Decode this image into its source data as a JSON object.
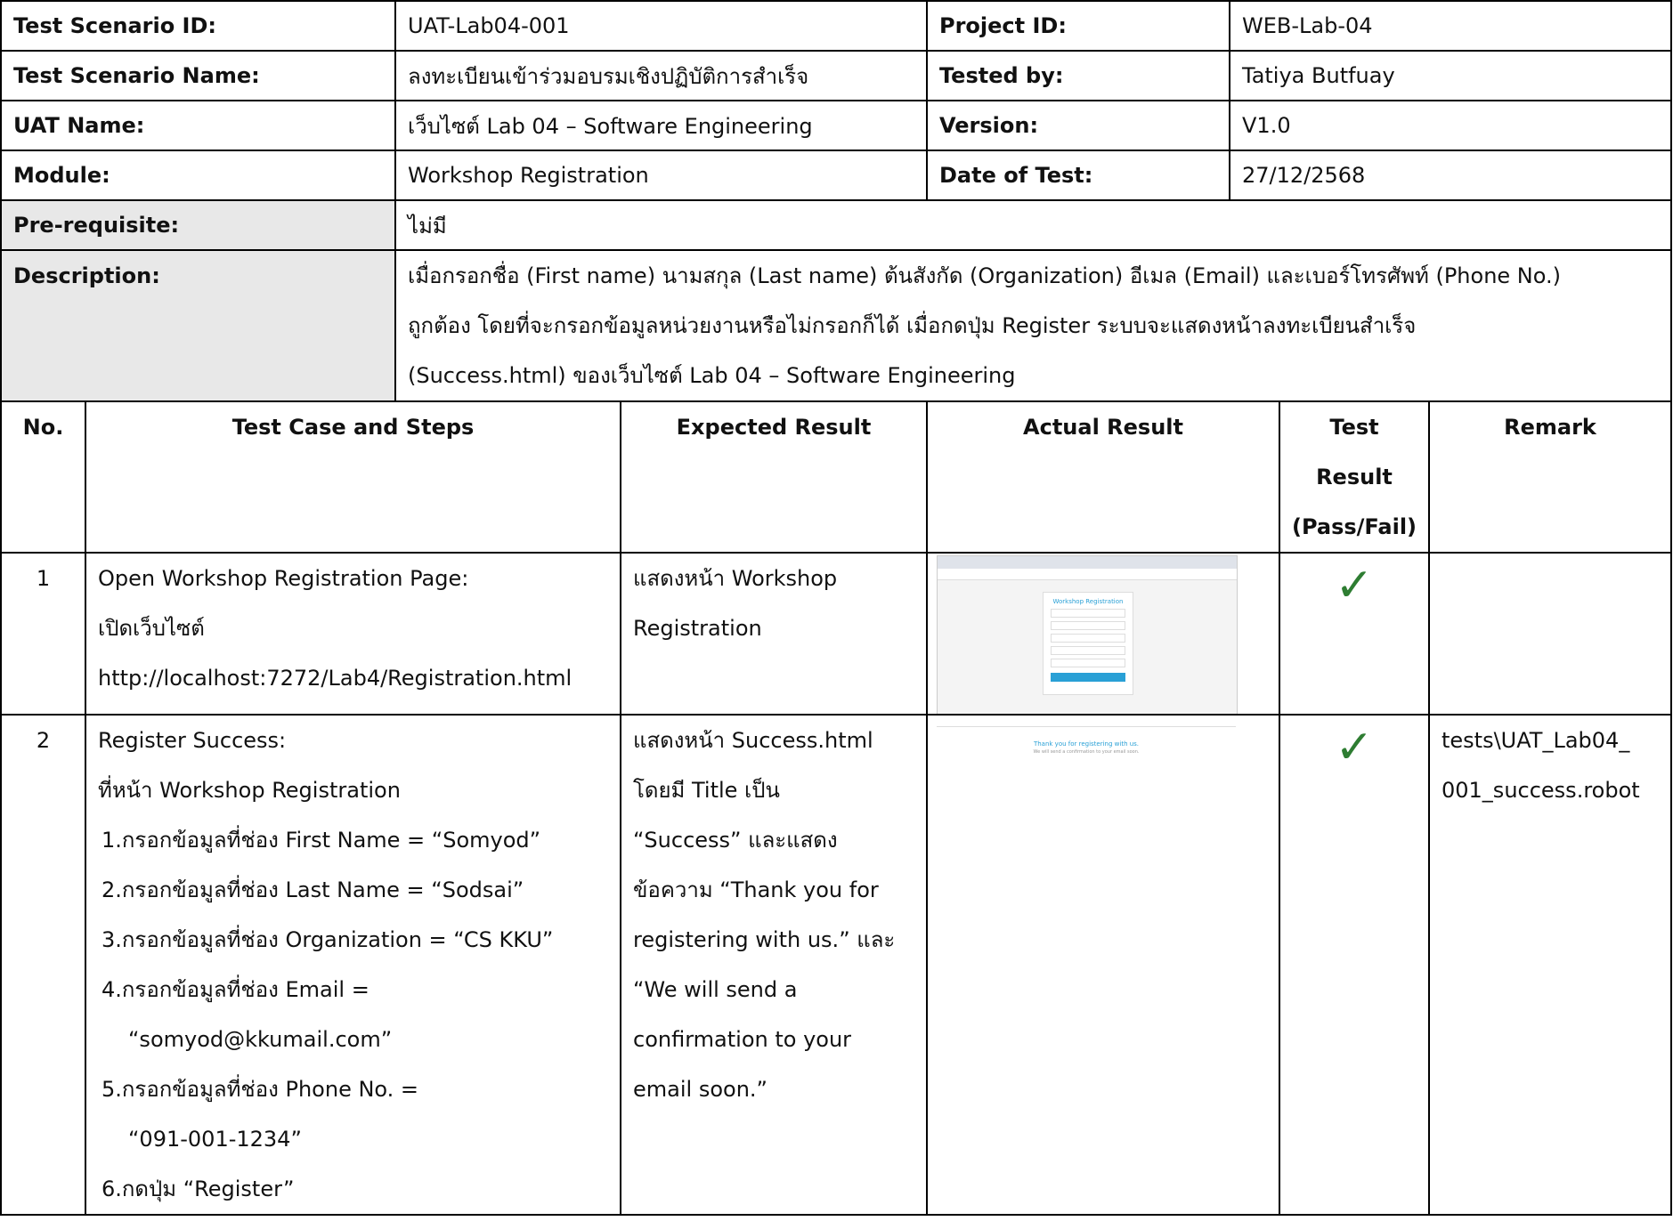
{
  "header": {
    "scenario_id_label": "Test Scenario ID:",
    "scenario_id_value": "UAT-Lab04-001",
    "project_id_label": "Project ID:",
    "project_id_value": "WEB-Lab-04",
    "scenario_name_label": "Test Scenario Name:",
    "scenario_name_value": "ลงทะเบียนเข้าร่วมอบรมเชิงปฏิบัติการสำเร็จ",
    "tested_by_label": "Tested by:",
    "tested_by_value": "Tatiya Butfuay",
    "uat_name_label": "UAT Name:",
    "uat_name_value": "เว็บไซต์ Lab 04 – Software Engineering",
    "version_label": "Version:",
    "version_value": "V1.0",
    "module_label": "Module:",
    "module_value": "Workshop Registration",
    "date_label": "Date of Test:",
    "date_value": "27/12/2568",
    "prereq_label": "Pre-requisite:",
    "prereq_value": "ไม่มี",
    "description_label": "Description:",
    "description_lines": [
      "เมื่อกรอกชื่อ (First name) นามสกุล (Last name) ต้นสังกัด (Organization) อีเมล (Email) และเบอร์โทรศัพท์ (Phone No.)",
      "ถูกต้อง โดยที่จะกรอกข้อมูลหน่วยงานหรือไม่กรอกก็ได้ เมื่อกดปุ่ม Register ระบบจะแสดงหน้าลงทะเบียนสำเร็จ",
      "(Success.html) ของเว็บไซต์ Lab 04 – Software Engineering"
    ]
  },
  "columns": {
    "no": "No.",
    "steps": "Test Case and Steps",
    "expected": "Expected Result",
    "actual": "Actual Result",
    "result_lines": [
      "Test",
      "Result",
      "(Pass/Fail)"
    ],
    "remark": "Remark"
  },
  "cases": [
    {
      "no": "1",
      "steps": [
        "Open Workshop Registration Page:",
        "เปิดเว็บไซต์",
        "http://localhost:7272/Lab4/Registration.html"
      ],
      "expected": [
        "แสดงหน้า Workshop",
        "Registration"
      ],
      "actual_shot": {
        "title": "Workshop Registration",
        "button": "Register"
      },
      "result_icon": "checkmark-icon",
      "result_symbol": "✓",
      "remark": []
    },
    {
      "no": "2",
      "steps": [
        "Register Success:",
        "ที่หน้า Workshop Registration",
        "1.กรอกข้อมูลที่ช่อง First Name = “Somyod”",
        "2.กรอกข้อมูลที่ช่อง Last Name = “Sodsai”",
        "3.กรอกข้อมูลที่ช่อง Organization = “CS KKU”",
        "4.กรอกข้อมูลที่ช่อง Email =",
        "“somyod@kkumail.com”",
        "5.กรอกข้อมูลที่ช่อง Phone No. =",
        "“091-001-1234”",
        "6.กดปุ่ม “Register”"
      ],
      "expected": [
        "แสดงหน้า Success.html",
        "โดยมี Title เป็น",
        "“Success” และแสดง",
        "ข้อความ “Thank you for",
        "registering with us.” และ",
        "“We will send a",
        "confirmation to your",
        "email soon.”"
      ],
      "actual_shot": {
        "title": "Thank you for registering with us.",
        "subtitle": "We will send a confirmation to your email soon."
      },
      "result_icon": "checkmark-icon",
      "result_symbol": "✓",
      "remark": [
        "tests\\UAT_Lab04_",
        "001_success.robot"
      ]
    }
  ]
}
